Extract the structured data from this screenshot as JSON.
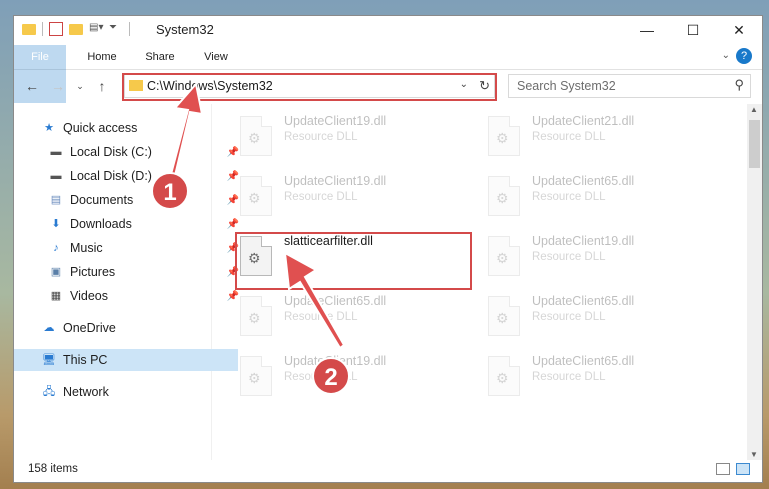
{
  "window": {
    "title": "System32",
    "controls": {
      "minimize": "—",
      "maximize": "☐",
      "close": "✕"
    }
  },
  "ribbon": {
    "tabs": [
      "File",
      "Home",
      "Share",
      "View"
    ],
    "help": "?"
  },
  "navigation": {
    "address": "C:\\Windows\\System32",
    "search_placeholder": "Search System32"
  },
  "sidebar": {
    "items": [
      {
        "label": "Quick access",
        "icon": "star-icon",
        "pinned": false
      },
      {
        "label": "Local Disk (C:)",
        "icon": "drive-icon",
        "pinned": true
      },
      {
        "label": "Local Disk (D:)",
        "icon": "drive-icon",
        "pinned": true
      },
      {
        "label": "Documents",
        "icon": "documents-icon",
        "pinned": true
      },
      {
        "label": "Downloads",
        "icon": "download-icon",
        "pinned": true
      },
      {
        "label": "Music",
        "icon": "music-icon",
        "pinned": true
      },
      {
        "label": "Pictures",
        "icon": "pictures-icon",
        "pinned": true
      },
      {
        "label": "Videos",
        "icon": "videos-icon",
        "pinned": true
      },
      {
        "label": "OneDrive",
        "icon": "cloud-icon",
        "pinned": false
      },
      {
        "label": "This PC",
        "icon": "computer-icon",
        "pinned": false,
        "selected": true
      },
      {
        "label": "Network",
        "icon": "network-icon",
        "pinned": false
      }
    ]
  },
  "files": [
    {
      "name": "UpdateClient19.dll",
      "type": "Resource DLL"
    },
    {
      "name": "UpdateClient21.dll",
      "type": "Resource DLL"
    },
    {
      "name": "UpdateClient19.dll",
      "type": "Resource DLL"
    },
    {
      "name": "UpdateClient65.dll",
      "type": "Resource DLL"
    },
    {
      "name": "slatticearfilter.dll",
      "type": "",
      "highlighted": true
    },
    {
      "name": "UpdateClient19.dll",
      "type": "Resource DLL"
    },
    {
      "name": "UpdateClient65.dll",
      "type": "Resource DLL"
    },
    {
      "name": "UpdateClient65.dll",
      "type": "Resource DLL"
    },
    {
      "name": "UpdateClient19.dll",
      "type": "Resource DLL"
    },
    {
      "name": "UpdateClient65.dll",
      "type": "Resource DLL"
    }
  ],
  "status": {
    "item_count": "158 items"
  },
  "annotations": {
    "step1": "1",
    "step2": "2"
  },
  "colors": {
    "accent": "#1979ca",
    "highlight": "#d44a4a",
    "selection": "#cce4f7"
  }
}
